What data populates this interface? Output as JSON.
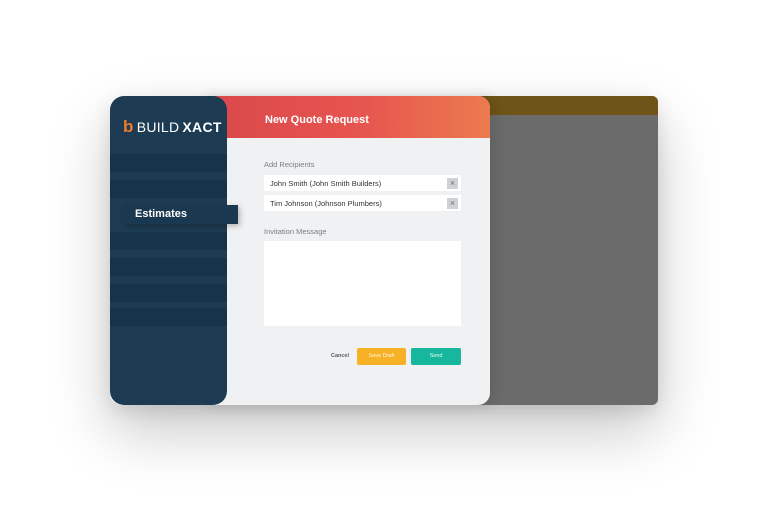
{
  "brand": {
    "mark": "b",
    "name_part1": "BUILD",
    "name_part2": "XACT",
    "accent_color": "#f07a2b"
  },
  "sidebar": {
    "active_item_label": "Estimates",
    "background_color": "#1d3b53"
  },
  "modal": {
    "title": "New Quote Request",
    "header_gradient": [
      "#d9474b",
      "#ec7a4e"
    ],
    "recipients_label": "Add Recipients",
    "recipients": [
      {
        "label": "John Smith (John Smith Builders)",
        "remove_icon": "×"
      },
      {
        "label": "Tim Johnson (Johnson Plumbers)",
        "remove_icon": "×"
      }
    ],
    "message_label": "Invitation Message",
    "message_value": "",
    "buttons": {
      "cancel": "Cancel",
      "save_draft": "Save Draft",
      "send": "Send"
    },
    "button_colors": {
      "save_draft": "#f6b124",
      "send": "#17b79d"
    }
  },
  "icons": {
    "remove": "close-icon"
  }
}
